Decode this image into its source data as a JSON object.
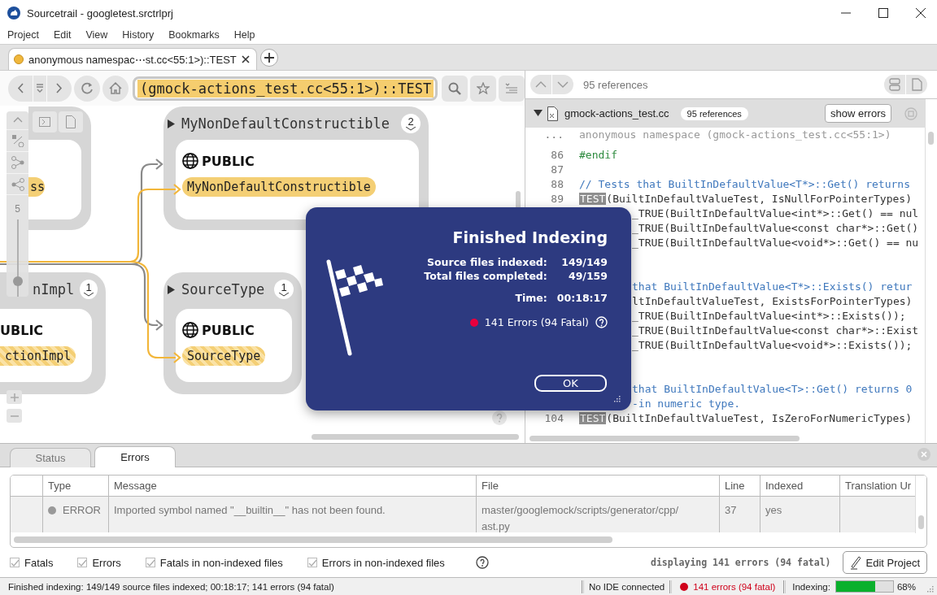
{
  "window": {
    "title": "Sourcetrail - googletest.srctrlprj"
  },
  "menu": [
    "Project",
    "Edit",
    "View",
    "History",
    "Bookmarks",
    "Help"
  ],
  "tabs": [
    {
      "label": "anonymous namespac⋯st.cc<55:1>)::TEST",
      "selected": true
    }
  ],
  "search": {
    "value": "(gmock-actions_test.cc<55:1>)::TEST"
  },
  "graph": {
    "depth_slider": {
      "label": "5",
      "level": 0.2
    },
    "nodes": [
      {
        "member": "ss",
        "hatched": false
      },
      {
        "name": "MyNonDefaultConstructible",
        "count": "2",
        "expanded": false,
        "access": "PUBLIC",
        "member": "MyNonDefaultConstructible",
        "hatched": false
      },
      {
        "name": "nImpl",
        "count": "1",
        "access": "UBLIC",
        "member": "ctionImpl",
        "hatched": true
      },
      {
        "name": "SourceType",
        "count": "1",
        "expanded": false,
        "access": "PUBLIC",
        "member": "SourceType",
        "hatched": true
      }
    ]
  },
  "code": {
    "references": "95 references",
    "file": {
      "name": "gmock-actions_test.cc",
      "expanded": true,
      "badge": "95 references",
      "button": "show errors"
    },
    "lines": [
      {
        "number": "...",
        "text": "anonymous namespace (gmock-actions_test.cc<55:1>)",
        "kind": "context"
      },
      {
        "number": "86",
        "text": "#endif",
        "kind": "preprocessor"
      },
      {
        "number": "87",
        "kind": "code"
      },
      {
        "number": "88",
        "text": "// Tests that BuiltInDefaultValue<T*>::Get() returns",
        "kind": "comment"
      },
      {
        "number": "89",
        "macro": "TEST",
        "text": "(BuiltInDefaultValueTest, IsNullForPointerTypes)",
        "kind": "code"
      },
      {
        "text": "_TRUE(BuiltInDefaultValue<int*>::Get() == nul",
        "kind": "code",
        "occluded": true
      },
      {
        "text": "_TRUE(BuiltInDefaultValue<const char*>::Get()",
        "kind": "code",
        "occluded": true
      },
      {
        "text": "_TRUE(BuiltInDefaultValue<void*>::Get() == nu",
        "kind": "code",
        "occluded": true
      },
      {
        "kind": "code"
      },
      {
        "kind": "code"
      },
      {
        "text": "that BuiltInDefaultValue<T*>::Exists() retur",
        "kind": "comment",
        "occluded": true
      },
      {
        "text": "ltInDefaultValueTest, ExistsForPointerTypes)",
        "kind": "code",
        "occluded": true
      },
      {
        "text": "_TRUE(BuiltInDefaultValue<int*>::Exists());",
        "kind": "code",
        "occluded": true
      },
      {
        "text": "_TRUE(BuiltInDefaultValue<const char*>::Exist",
        "kind": "code",
        "occluded": true
      },
      {
        "text": "_TRUE(BuiltInDefaultValue<void*>::Exists());",
        "kind": "code",
        "occluded": true
      },
      {
        "kind": "code"
      },
      {
        "kind": "code"
      },
      {
        "text": "that BuiltInDefaultValue<T>::Get() returns 0",
        "kind": "comment",
        "occluded": true
      },
      {
        "text": "-in numeric type.",
        "kind": "comment",
        "occluded": true
      },
      {
        "number": "104",
        "macro": "TEST",
        "text": "(BuiltInDefaultValueTest, IsZeroForNumericTypes)",
        "kind": "code"
      }
    ]
  },
  "dialog": {
    "title": "Finished Indexing",
    "stats": [
      {
        "label": "Source files indexed:",
        "value": "149/149"
      },
      {
        "label": "Total files completed:",
        "value": "49/159"
      },
      {
        "label": "Time:",
        "value": "00:18:17"
      }
    ],
    "errors": "141 Errors (94 Fatal)",
    "button": "OK"
  },
  "bottom_panel": {
    "tabs": [
      {
        "label": "Status",
        "selected": false
      },
      {
        "label": "Errors",
        "selected": true
      }
    ],
    "columns": [
      "Type",
      "Message",
      "File",
      "Line",
      "Indexed",
      "Translation Ur"
    ],
    "rows": [
      {
        "type": "ERROR",
        "message": "Imported symbol named \"__builtin__\" has not been found.",
        "file": [
          "master/googlemock/scripts/generator/cpp/",
          "ast.py"
        ],
        "line": "37",
        "indexed": "yes"
      }
    ],
    "filters": [
      {
        "label": "Fatals",
        "checked": true
      },
      {
        "label": "Errors",
        "checked": true
      },
      {
        "label": "Fatals in non-indexed files",
        "checked": true
      },
      {
        "label": "Errors in non-indexed files",
        "checked": true
      }
    ],
    "summary": "displaying 141 errors (94 fatal)",
    "button": "Edit Project"
  },
  "status_bar": {
    "message": "Finished indexing: 149/149 source files indexed; 00:18:17; 141 errors (94 fatal)",
    "ide": "No IDE connected",
    "errors": "141 errors (94 fatal)",
    "indexing": {
      "label": "Indexing:",
      "level": 0.68,
      "percent": "68%"
    }
  }
}
